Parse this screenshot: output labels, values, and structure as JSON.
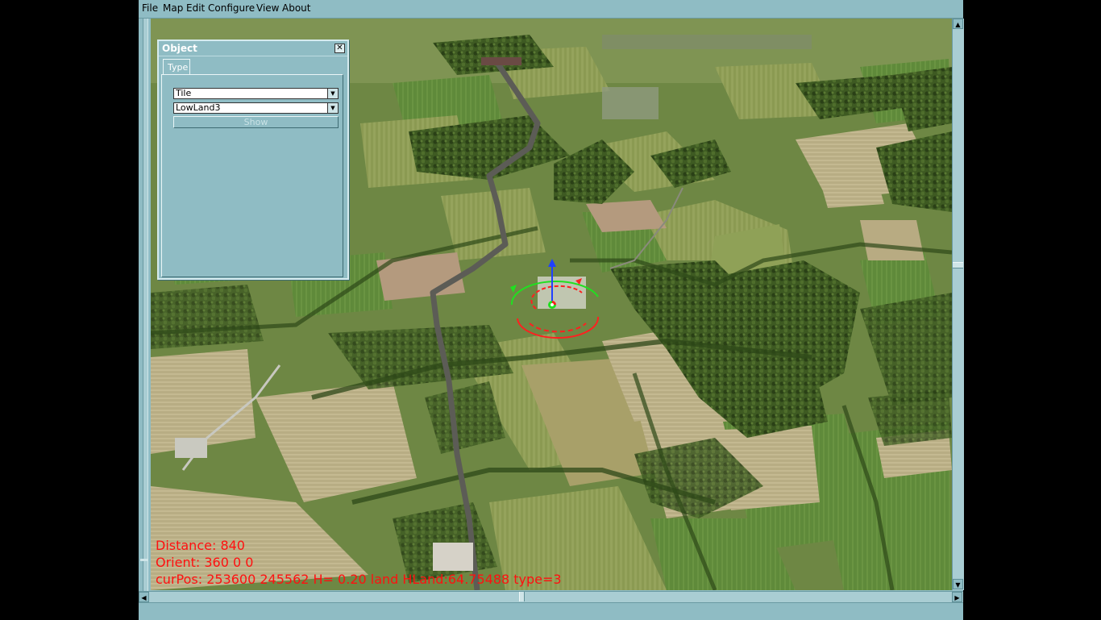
{
  "menubar": {
    "items": [
      "File",
      "Map",
      "Edit",
      "Configure",
      "View",
      "About"
    ]
  },
  "object_panel": {
    "title": "Object",
    "tab_label": "Type",
    "category_value": "Tile",
    "tile_value": "LowLand3",
    "show_label": "Show"
  },
  "overlay": {
    "distance": "Distance: 840",
    "orient": "Orient: 360 0 0",
    "curpos": "curPos: 253600 245562 H= 0.20 land HLand:64.75488 type=3"
  },
  "icons": {
    "close": "close-icon",
    "dropdown": "chevron-down-icon",
    "arrow_up": "arrow-up-icon",
    "arrow_down": "arrow-down-icon",
    "arrow_left": "arrow-left-icon",
    "arrow_right": "arrow-right-icon"
  },
  "colors": {
    "chrome": "#8fbcc4",
    "overlay_text": "#ff1010",
    "gizmo_green": "#20e020",
    "gizmo_red": "#ff2020",
    "gizmo_blue": "#2040ff"
  }
}
